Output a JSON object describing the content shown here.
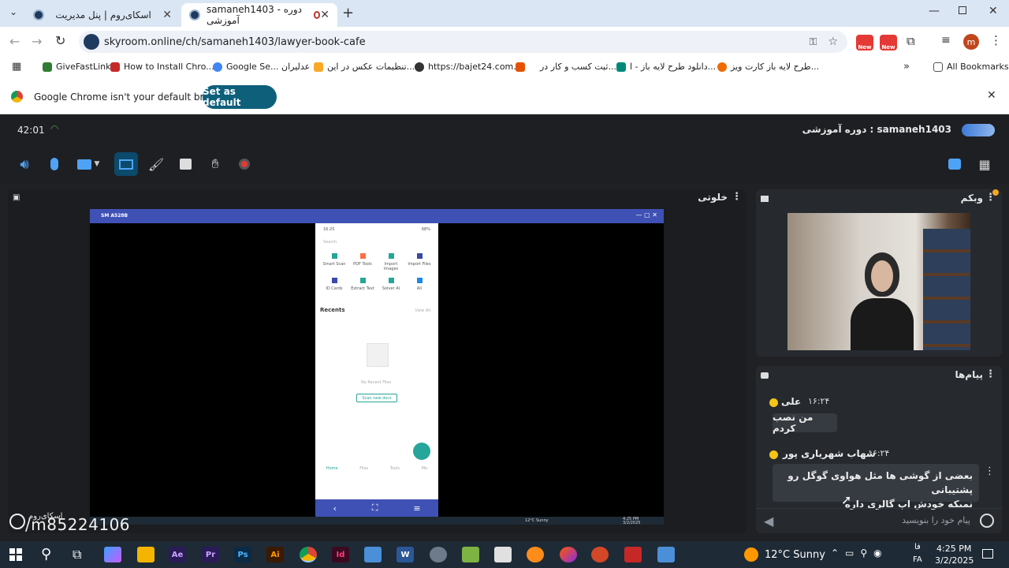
{
  "browser": {
    "tabs": [
      {
        "title": "اسکای‌روم | پنل مدیریت"
      },
      {
        "title": "samaneh1403 - دوره آموزشی"
      }
    ],
    "url": "skyroom.online/ch/samaneh1403/lawyer-book-cafe",
    "bookmarks": [
      "GiveFastLink",
      "How to Install Chro...",
      "Google Se... عدلیران",
      "تنظیمات عکس در این...",
      "https://bajet24.com...",
      "ثبت کسب و کار در...",
      "دانلود طرح لایه باز - ا...",
      "طرح لایه باز کارت ویز...",
      "All Bookmarks"
    ],
    "infobar": {
      "message": "Google Chrome isn't your default browser",
      "button": "Set as default"
    },
    "profile_initial": "m",
    "new_badge": "New"
  },
  "room": {
    "timer": "42:01",
    "title": "samaneh1403 : دوره آموزشی",
    "main_panel_title": "خلوتی",
    "webcam_title": "وبکم",
    "messages_title": "پیام‌ها",
    "messages": [
      {
        "sender": "علی",
        "time": "۱۶:۲۴",
        "text": "من نصب کردم"
      },
      {
        "sender": "شهاب شهریاری پور",
        "time": "۱۶:۲۴",
        "text_line1": "بعضی از گوشی ها مثل هواوی گوگل رو پشتیبانی",
        "text_line2": "نمیکه خودش اپ گالری داره"
      }
    ],
    "input_placeholder": "پیام خود را بنویسید",
    "watermark": "/m85224106",
    "watermark_brand": "اسکای‌روم"
  },
  "shared_screen": {
    "window_title": "SM A528B",
    "phone": {
      "status": "16:25",
      "battery": "68%",
      "search": "Search",
      "tools": [
        "Smart Scan",
        "PDF Tools",
        "Import Images",
        "Import Files",
        "ID Cards",
        "Extract Text",
        "Solver AI",
        "All"
      ],
      "recents": "Recents",
      "view_all": "View All",
      "empty": "No Recent Files",
      "scan_btn": "Scan new docs",
      "nav": [
        "Home",
        "Files",
        "Tools",
        "Me"
      ]
    },
    "mini_weather": "12°C Sunny",
    "mini_time": "4:25 PM",
    "mini_date": "3/2/2025"
  },
  "taskbar": {
    "weather": "12°C Sunny",
    "time": "4:25 PM",
    "date": "3/2/2025",
    "lang": "FA",
    "lang2": "فا",
    "apps": [
      "Ae",
      "Pr",
      "Ps",
      "Ai",
      "Id"
    ]
  }
}
